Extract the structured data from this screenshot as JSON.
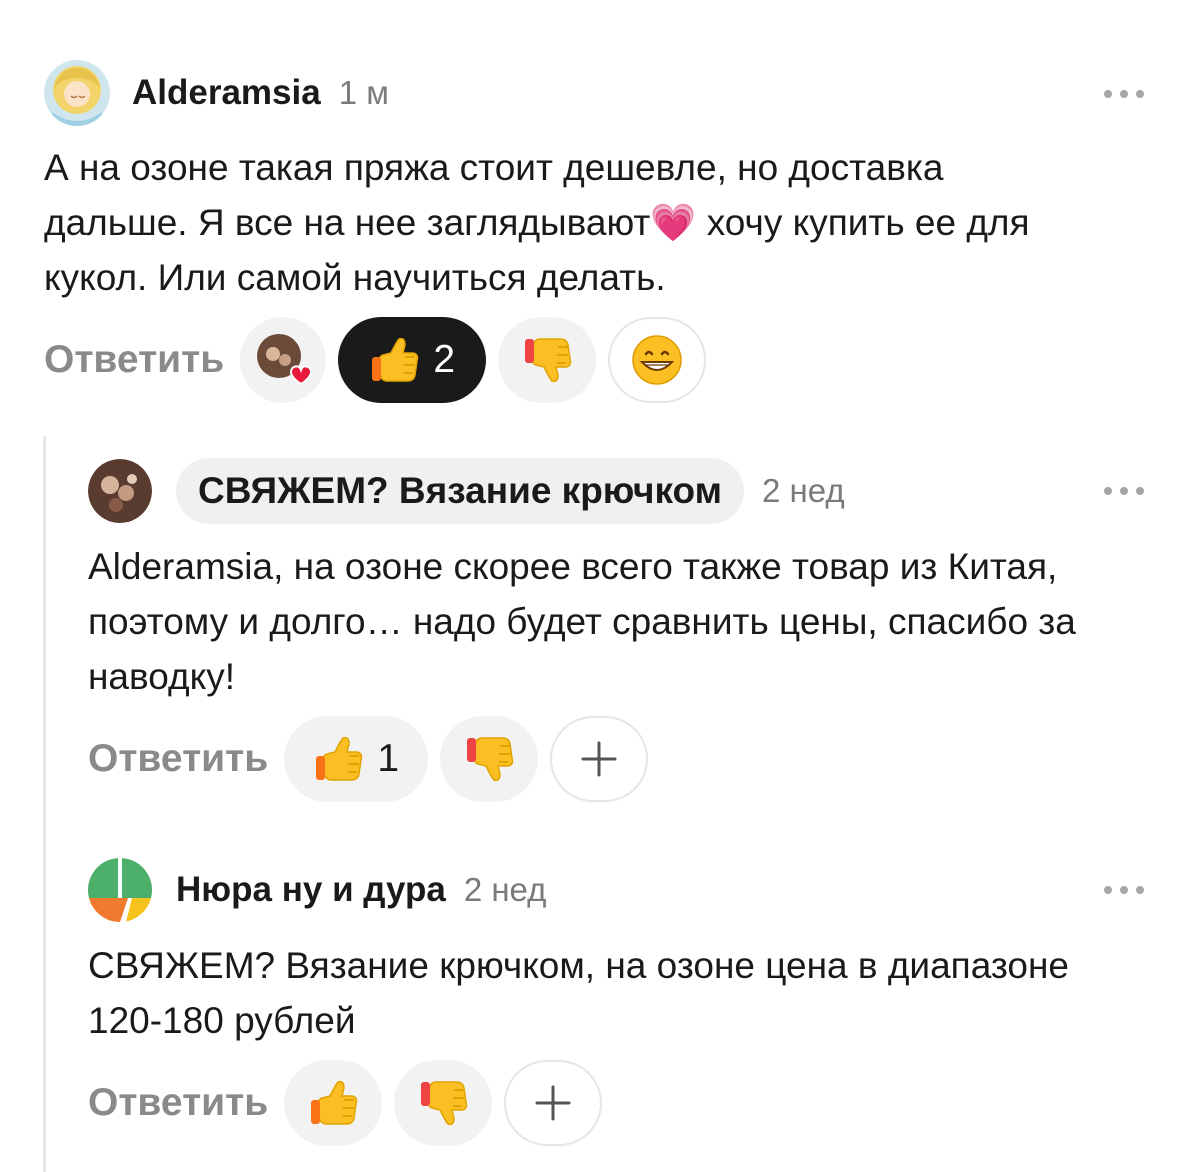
{
  "comments": [
    {
      "author": "Alderamsia",
      "time": "1 м",
      "text_lines": [
        "А на озоне такая пряжа стоит дешевле, но доставка",
        "дальше. Я все на нее заглядывают💗 хочу купить ее для",
        "кукол. Или самой научиться делать."
      ],
      "reply_label": "Ответить",
      "likes": "2"
    },
    {
      "author": "СВЯЖЕМ? Вязание крючком",
      "time": "2 нед",
      "text_lines": [
        "Alderamsia, на озоне скорее всего также товар из Китая,",
        "поэтому и долго… надо будет сравнить цены, спасибо за",
        "наводку!"
      ],
      "reply_label": "Ответить",
      "likes": "1"
    },
    {
      "author": "Нюра ну и дура",
      "time": "2 нед",
      "text_lines": [
        "СВЯЖЕМ? Вязание крючком, на озоне цена в диапазоне",
        "120-180 рублей"
      ],
      "reply_label": "Ответить"
    }
  ],
  "icons": {
    "like": "thumbs-up-icon",
    "dislike": "thumbs-down-icon",
    "smile": "grinning-face-icon",
    "add": "plus-icon",
    "more": "more-dots-icon"
  },
  "colors": {
    "like_active_bg": "#1a1a1a",
    "pill_bg": "#f2f2f2",
    "muted_text": "#8a8a8a",
    "heart": "#e8193a"
  }
}
